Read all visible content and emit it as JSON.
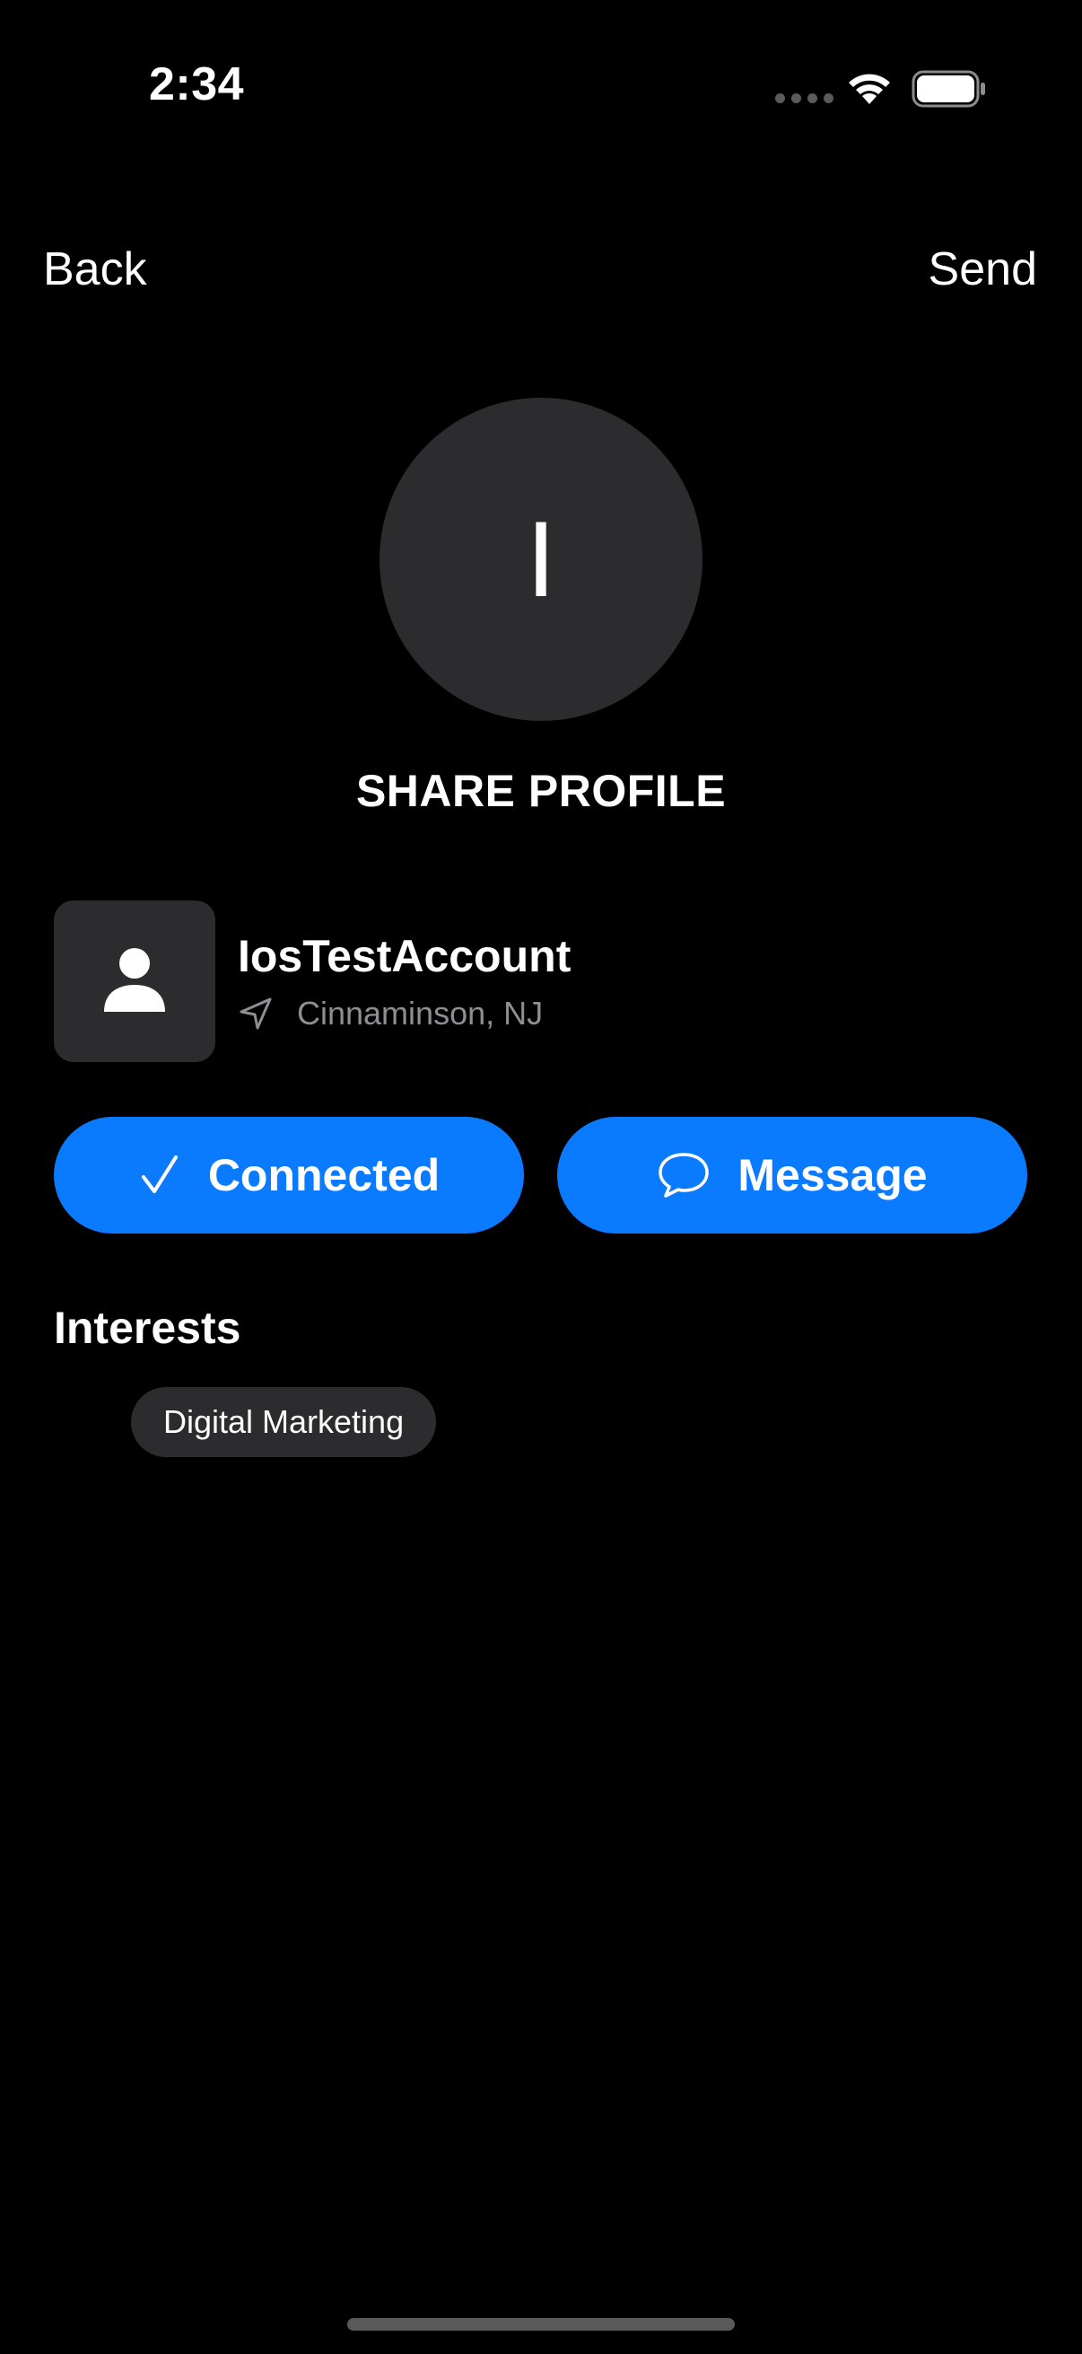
{
  "status_bar": {
    "time": "2:34",
    "icons": [
      "signal-dots-icon",
      "wifi-icon",
      "battery-icon"
    ]
  },
  "nav": {
    "back_label": "Back",
    "send_label": "Send"
  },
  "avatar": {
    "initial": "I"
  },
  "title": "SHARE PROFILE",
  "profile": {
    "name": "IosTestAccount",
    "location": "Cinnaminson, NJ",
    "thumb_icon": "person-icon",
    "location_icon": "location-arrow-icon"
  },
  "actions": {
    "connected_label": "Connected",
    "connected_icon": "checkmark-icon",
    "message_label": "Message",
    "message_icon": "speech-bubble-icon"
  },
  "interests": {
    "title": "Interests",
    "items": [
      "Digital Marketing"
    ]
  },
  "colors": {
    "background": "#000000",
    "surface": "#2c2c2e",
    "accent": "#0a7bff",
    "secondary_text": "#8e8e93"
  }
}
